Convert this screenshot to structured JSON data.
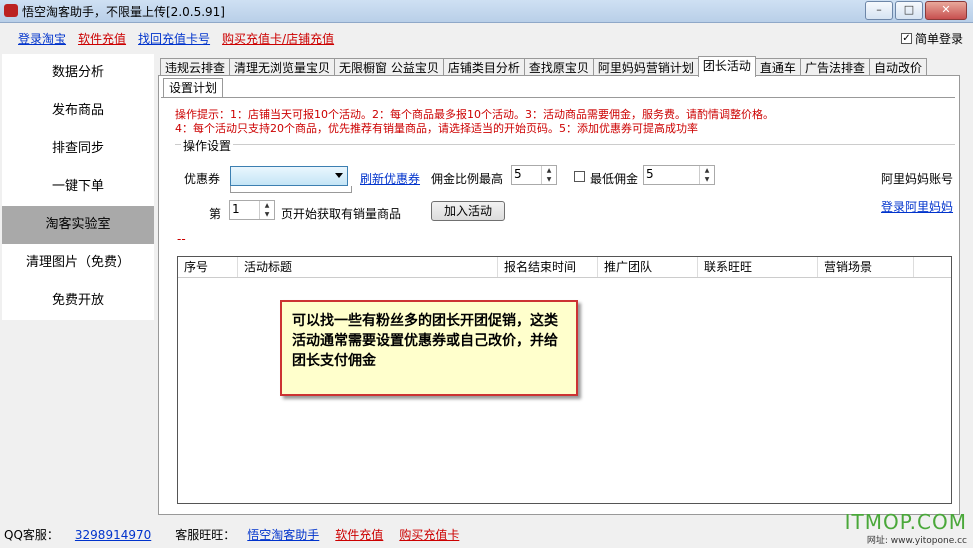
{
  "window": {
    "title": "悟空淘客助手，不限量上传[2.0.5.91]"
  },
  "top_links": [
    {
      "label": "登录淘宝",
      "color": "blue"
    },
    {
      "label": "软件充值",
      "color": "red"
    },
    {
      "label": "找回充值卡号",
      "color": "blue"
    },
    {
      "label": "购买充值卡/店铺充值",
      "color": "red"
    }
  ],
  "simple_login": {
    "label": "简单登录",
    "checked": true
  },
  "sidebar": {
    "items": [
      "数据分析",
      "发布商品",
      "排查同步",
      "一键下单",
      "淘客实验室",
      "清理图片（免费）",
      "免费开放"
    ],
    "active_index": 4
  },
  "tabs": {
    "items": [
      "违规云排查",
      "清理无浏览量宝贝",
      "无限橱窗  公益宝贝",
      "店铺类目分析",
      "查找原宝贝",
      "阿里妈妈营销计划",
      "团长活动",
      "直通车",
      "广告法排查",
      "自动改价"
    ],
    "active_index": 6
  },
  "subtab": {
    "label": "设置计划"
  },
  "hint": {
    "line1": "操作提示：1：店铺当天可报10个活动。2：每个商品最多报10个活动。3：活动商品需要佣金，服务费。请酌情调整价格。",
    "line2": "4：每个活动只支持20个商品，优先推荐有销量商品，请选择适当的开始页码。5：添加优惠券可提高成功率"
  },
  "settings": {
    "legend": "操作设置",
    "coupon_label": "优惠券",
    "refresh_link": "刷新优惠券",
    "max_ratio_label": "佣金比例最高",
    "max_ratio_value": "5",
    "min_commission_label": "最低佣金",
    "min_commission_value": "5",
    "min_commission_checked": false,
    "alimama_account_label": "阿里妈妈账号",
    "alimama_login_link": "登录阿里妈妈",
    "page_prefix": "第",
    "page_value": "1",
    "page_suffix": "页开始获取有销量商品",
    "add_button": "加入活动",
    "dash": "--"
  },
  "table": {
    "columns": [
      "序号",
      "活动标题",
      "报名结束时间",
      "推广团队",
      "联系旺旺",
      "营销场景"
    ],
    "rows": []
  },
  "callout": {
    "text": "可以找一些有粉丝多的团长开团促销，这类活动通常需要设置优惠券或自己改价，并给团长支付佣金"
  },
  "footer": {
    "qq_label": "QQ客服：",
    "qq_number": "3298914970",
    "wangwang_label": "客服旺旺：",
    "links": [
      {
        "label": "悟空淘客助手",
        "color": "blue"
      },
      {
        "label": "软件充值",
        "color": "red"
      },
      {
        "label": "购买充值卡",
        "color": "red"
      }
    ]
  },
  "watermark": {
    "big": "ITMOP.COM",
    "small": "网址: www.yitopone.cc"
  },
  "colors": {
    "link_blue": "#0033cc",
    "link_red": "#cc0000",
    "callout_bg": "#ffffcc",
    "callout_border": "#cc3333",
    "sidebar_active": "#a9a9a9"
  }
}
